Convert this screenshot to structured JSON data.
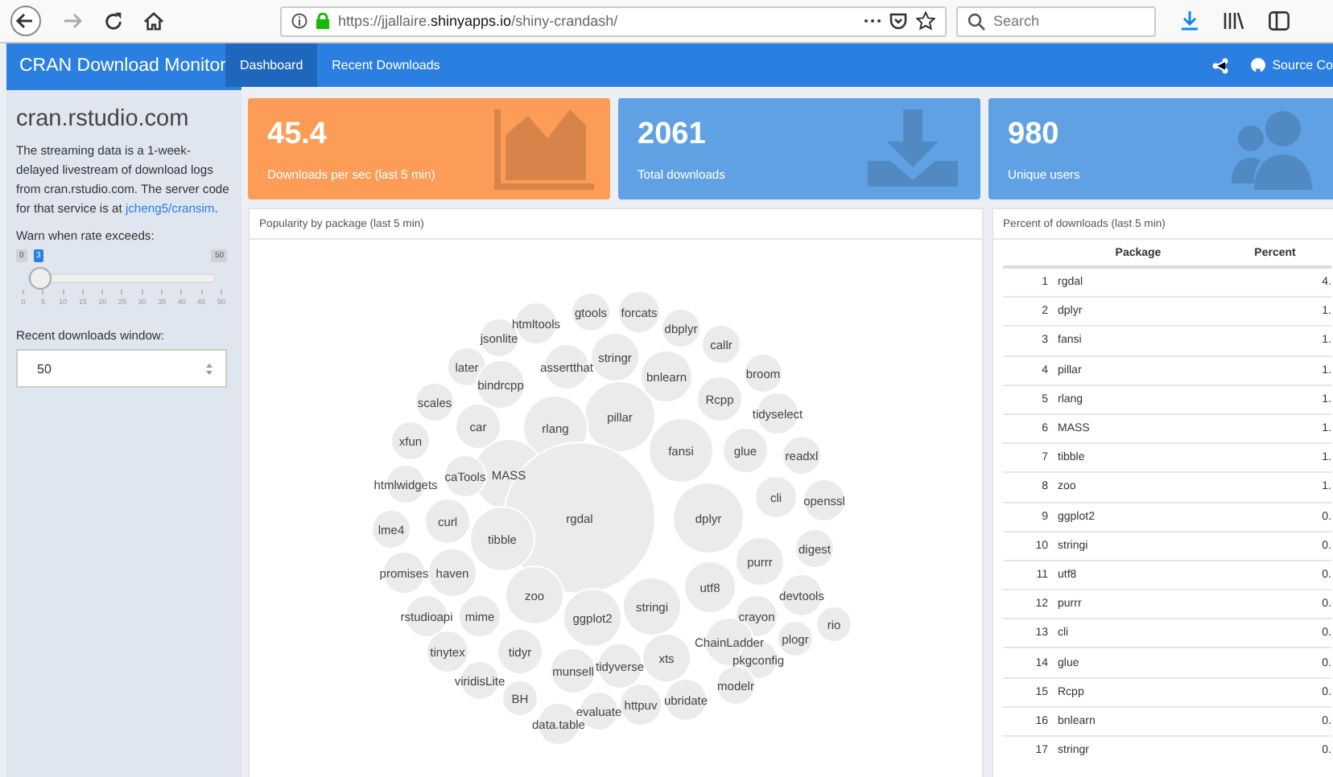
{
  "browser": {
    "url_prefix": "https://jjallaire.",
    "url_domain": "shinyapps.io",
    "url_path": "/shiny-crandash/",
    "search_placeholder": "Search"
  },
  "navbar": {
    "brand": "CRAN Download Monitor",
    "tabs": [
      {
        "label": "Dashboard",
        "selected": true
      },
      {
        "label": "Recent Downloads",
        "selected": false
      }
    ],
    "source_link": "Source Co"
  },
  "sidebar": {
    "title": "cran.rstudio.com",
    "description": "The streaming data is a 1-week-delayed livestream of download logs from cran.rstudio.com. The server code for that service is at ",
    "link": "jcheng5/cransim",
    "link_after": ".",
    "slider": {
      "label": "Warn when rate exceeds:",
      "min": "0",
      "max": "50",
      "value": "3",
      "level": 0.06,
      "ticks": [
        "0",
        "5",
        "10",
        "15",
        "20",
        "25",
        "30",
        "35",
        "40",
        "45",
        "50"
      ]
    },
    "window_input": {
      "label": "Recent downloads window:",
      "value": "50"
    }
  },
  "value_boxes": [
    {
      "kind": "area",
      "value": "45.4",
      "caption": "Downloads per sec (last 5 min)",
      "color": "#fc9c57"
    },
    {
      "kind": "download",
      "value": "2061",
      "caption": "Total downloads",
      "color": "#60a1e4"
    },
    {
      "kind": "users",
      "value": "980",
      "caption": "Unique users",
      "color": "#60a1e4"
    }
  ],
  "bubble_panel": {
    "title": "Popularity by package (last 5 min)",
    "bubbles": [
      "gtools",
      "forcats",
      "htmltools",
      "dbplyr",
      "jsonlite",
      "callr",
      "stringr",
      "later",
      "assertthat",
      "broom",
      "bnlearn",
      "bindrcpp",
      "Rcpp",
      "scales",
      "tidyselect",
      "pillar",
      "car",
      "rlang",
      "xfun",
      "fansi",
      "glue",
      "readxl",
      "MASS",
      "caTools",
      "htmlwidgets",
      "cli",
      "openssl",
      "curl",
      "rgdal",
      "dplyr",
      "lme4",
      "tibble",
      "digest",
      "purrr",
      "promises",
      "haven",
      "utf8",
      "zoo",
      "devtools",
      "stringi",
      "rstudioapi",
      "mime",
      "ggplot2",
      "crayon",
      "rio",
      "plogr",
      "ChainLadder",
      "tinytex",
      "tidyr",
      "xts",
      "pkgconfig",
      "tidyverse",
      "munsell",
      "viridisLite",
      "modelr",
      "BH",
      "ubridate",
      "httpuv",
      "evaluate",
      "data.table"
    ]
  },
  "table_panel": {
    "title": "Percent of downloads (last 5 min)",
    "columns": [
      "",
      "Package",
      "Percent"
    ],
    "rows": [
      [
        "1",
        "rgdal",
        "4."
      ],
      [
        "2",
        "dplyr",
        "1."
      ],
      [
        "3",
        "fansi",
        "1."
      ],
      [
        "4",
        "pillar",
        "1."
      ],
      [
        "5",
        "rlang",
        "1."
      ],
      [
        "6",
        "MASS",
        "1."
      ],
      [
        "7",
        "tibble",
        "1."
      ],
      [
        "8",
        "zoo",
        "1."
      ],
      [
        "9",
        "ggplot2",
        "0."
      ],
      [
        "10",
        "stringi",
        "0."
      ],
      [
        "11",
        "utf8",
        "0."
      ],
      [
        "12",
        "purrr",
        "0."
      ],
      [
        "13",
        "cli",
        "0."
      ],
      [
        "14",
        "glue",
        "0."
      ],
      [
        "15",
        "Rcpp",
        "0."
      ],
      [
        "16",
        "bnlearn",
        "0."
      ],
      [
        "17",
        "stringr",
        "0."
      ]
    ]
  }
}
